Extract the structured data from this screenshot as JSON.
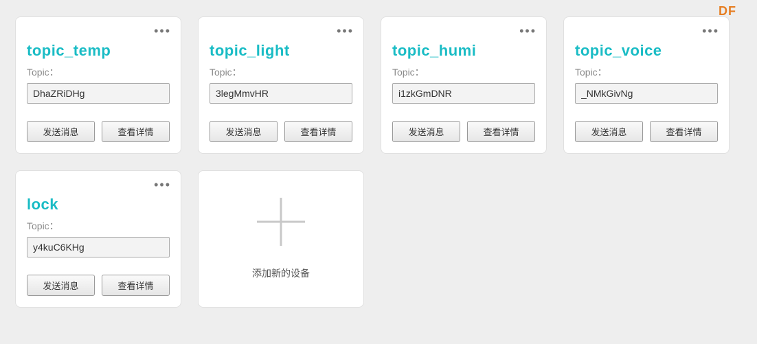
{
  "watermark": {
    "prefix": "DF"
  },
  "labels": {
    "topic_label": "Topic：",
    "send_button": "发送消息",
    "details_button": "查看详情",
    "add_new_device": "添加新的设备",
    "menu_dots": "•••"
  },
  "cards": [
    {
      "title": "topic_temp",
      "topic_value": "DhaZRiDHg"
    },
    {
      "title": "topic_light",
      "topic_value": "3legMmvHR"
    },
    {
      "title": "topic_humi",
      "topic_value": "i1zkGmDNR"
    },
    {
      "title": "topic_voice",
      "topic_value": "_NMkGivNg"
    },
    {
      "title": "lock",
      "topic_value": "y4kuC6KHg"
    }
  ]
}
